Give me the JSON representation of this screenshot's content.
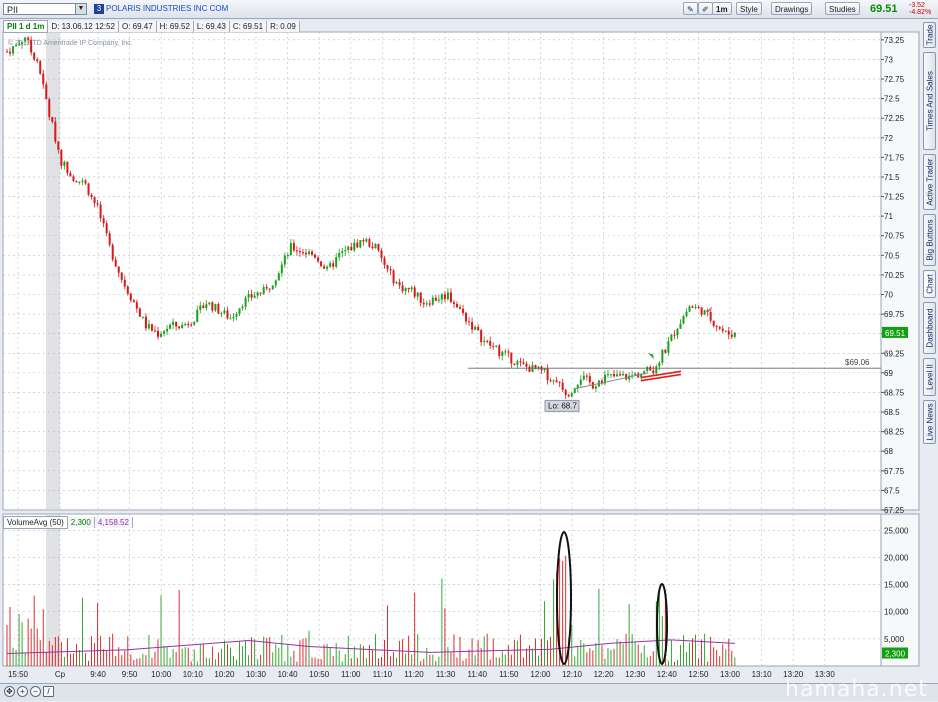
{
  "toolbar": {
    "symbol": "PII",
    "link_number": "3",
    "company": "POLARIS INDUSTRIES INC COM",
    "interval": "1m",
    "style_label": "Style",
    "drawings_label": "Drawings",
    "studies_label": "Studies",
    "last_price": "69.51",
    "change": "-3.52",
    "change_pct": "-4.82%"
  },
  "infobar": {
    "title": "PII 1 d 1m",
    "date": "D: 13.06.12 12:52",
    "open": "O: 69.47",
    "high": "H: 69.52",
    "low": "L: 69.43",
    "close": "C: 69.51",
    "range": "R: 0.09"
  },
  "copyright": "© 2012 TD Ameritrade IP Company, Inc.",
  "side_tabs": [
    "Trade",
    "Times And Sales",
    "Active Trader",
    "Big Buttons",
    "Chart",
    "Dashboard",
    "Level II",
    "Live News"
  ],
  "volume_panel": {
    "title": "VolumeAvg (50)",
    "volume": "2,300",
    "average": "4,158.52",
    "last_volume_label": "2,300"
  },
  "annotations": {
    "low_label": "Lo: 68.7",
    "level_label": "$69.06",
    "price_tag": "69.51"
  },
  "watermark": "hamaha.net",
  "colors": {
    "up": "#1aa01a",
    "down": "#d81818",
    "volume_avg": "#9a30a0",
    "grid": "#b8bcc4",
    "ellipse": "#111111",
    "trendline": "#e02020"
  },
  "chart_data": {
    "type": "candlestick",
    "price_axis": {
      "ticks": [
        73.25,
        73,
        72.75,
        72.5,
        72.25,
        72,
        71.75,
        71.5,
        71.25,
        71,
        70.75,
        70.5,
        70.25,
        70,
        69.75,
        69.5,
        69.25,
        69,
        68.75,
        68.5,
        68.25,
        68,
        67.75,
        67.5,
        67.25
      ],
      "labels": [
        "73.25",
        "73",
        "72.75",
        "72.5",
        "72.25",
        "72",
        "71.75",
        "71.5",
        "71.25",
        "71",
        "70.75",
        "70.5",
        "70.25",
        "70",
        "69.75",
        "69.5",
        "69.25",
        "69",
        "68.75",
        "68.5",
        "68.25",
        "68",
        "67.75",
        "67.5",
        "67.25"
      ],
      "range": [
        67.25,
        73.35
      ]
    },
    "volume_axis": {
      "ticks": [
        5000,
        10000,
        15000,
        20000,
        25000
      ],
      "labels": [
        "5,000",
        "10,000",
        "15,000",
        "20,000",
        "25,000"
      ],
      "range": [
        0,
        28000
      ]
    },
    "time_axis": [
      "15:50",
      "Cp",
      "9:40",
      "9:50",
      "10:00",
      "10:10",
      "10:20",
      "10:30",
      "10:40",
      "10:50",
      "11:00",
      "11:10",
      "11:20",
      "11:30",
      "11:40",
      "11:50",
      "12:00",
      "12:10",
      "12:20",
      "12:30",
      "12:40",
      "12:50",
      "13:00",
      "13:10",
      "13:20",
      "13:30"
    ],
    "price_path": [
      [
        0,
        73.1
      ],
      [
        2,
        73.2
      ],
      [
        3,
        73.3
      ],
      [
        4,
        73.1
      ],
      [
        5,
        73.0
      ],
      [
        7,
        72.3
      ],
      [
        9,
        71.7
      ],
      [
        11,
        71.5
      ],
      [
        13,
        71.4
      ],
      [
        15,
        71.1
      ],
      [
        17,
        70.6
      ],
      [
        19,
        70.2
      ],
      [
        21,
        69.9
      ],
      [
        23,
        69.6
      ],
      [
        25,
        69.5
      ],
      [
        27,
        69.6
      ],
      [
        29,
        69.6
      ],
      [
        31,
        69.7
      ],
      [
        33,
        69.9
      ],
      [
        35,
        69.8
      ],
      [
        37,
        69.7
      ],
      [
        39,
        69.9
      ],
      [
        41,
        70.0
      ],
      [
        43,
        70.05
      ],
      [
        45,
        70.3
      ],
      [
        47,
        70.6
      ],
      [
        49,
        70.55
      ],
      [
        51,
        70.5
      ],
      [
        53,
        70.3
      ],
      [
        55,
        70.5
      ],
      [
        57,
        70.6
      ],
      [
        59,
        70.7
      ],
      [
        61,
        70.6
      ],
      [
        63,
        70.3
      ],
      [
        65,
        70.1
      ],
      [
        67,
        70.05
      ],
      [
        69,
        69.9
      ],
      [
        71,
        69.95
      ],
      [
        73,
        70.0
      ],
      [
        75,
        69.8
      ],
      [
        77,
        69.6
      ],
      [
        79,
        69.4
      ],
      [
        81,
        69.3
      ],
      [
        83,
        69.2
      ],
      [
        85,
        69.1
      ],
      [
        87,
        69.05
      ],
      [
        89,
        69.0
      ],
      [
        91,
        68.85
      ],
      [
        93,
        68.75
      ],
      [
        95,
        68.95
      ],
      [
        97,
        68.85
      ],
      [
        99,
        68.95
      ],
      [
        101,
        68.95
      ],
      [
        103,
        68.95
      ],
      [
        105,
        69.0
      ],
      [
        107,
        69.05
      ],
      [
        109,
        69.3
      ],
      [
        111,
        69.6
      ],
      [
        113,
        69.85
      ],
      [
        115,
        69.8
      ],
      [
        117,
        69.65
      ],
      [
        119,
        69.5
      ],
      [
        121,
        69.5
      ]
    ],
    "volume_avg_path": [
      [
        0,
        2300
      ],
      [
        20,
        3000
      ],
      [
        40,
        4700
      ],
      [
        50,
        3600
      ],
      [
        70,
        2500
      ],
      [
        90,
        3100
      ],
      [
        100,
        4200
      ],
      [
        110,
        4800
      ],
      [
        121,
        4158.52
      ]
    ],
    "low": 68.7,
    "horizontal_level": 69.06,
    "last": 69.51,
    "last_volume": 2300
  }
}
